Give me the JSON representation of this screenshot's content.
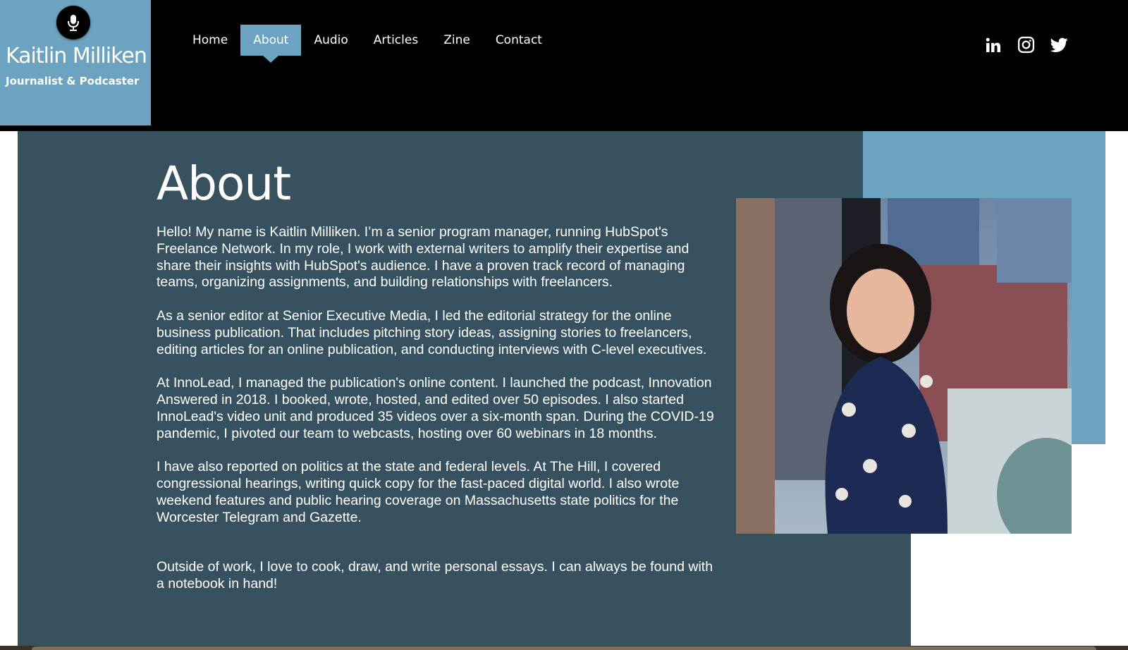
{
  "site": {
    "name": "Kaitlin Milliken",
    "tagline": "Journalist & Podcaster",
    "logo_icon": "microphone-icon"
  },
  "colors": {
    "header_bg": "#000000",
    "accent_blue": "#6ca3c0",
    "panel_slate": "#37515f",
    "text": "#ffffff"
  },
  "nav": {
    "items": [
      {
        "label": "Home",
        "active": false
      },
      {
        "label": "About",
        "active": true
      },
      {
        "label": "Audio",
        "active": false
      },
      {
        "label": "Articles",
        "active": false
      },
      {
        "label": "Zine",
        "active": false
      },
      {
        "label": "Contact",
        "active": false
      }
    ]
  },
  "social": [
    {
      "name": "LinkedIn",
      "icon": "linkedin-icon"
    },
    {
      "name": "Instagram",
      "icon": "instagram-icon"
    },
    {
      "name": "Twitter",
      "icon": "twitter-icon"
    }
  ],
  "main": {
    "title": "About",
    "paragraphs": [
      "Hello! My name is Kaitlin Milliken. I’m a senior program manager, running HubSpot's Freelance Network. In my role, I work with external writers to amplify their expertise and share their insights with HubSpot's audience. I have a proven track record of managing teams, organizing assignments, and building relationships with freelancers.",
      "As a senior editor at Senior Executive Media, I led the editorial strategy for the online business publication. That includes pitching story ideas, assigning stories to freelancers, editing articles for an online publication, and conducting interviews with C-level executives.",
      "At InnoLead, I managed the publication's online content. I launched the podcast, Innovation Answered in 2018. I booked, wrote, hosted, and edited over 50 episodes. I also started InnoLead's video unit and produced 35 videos over a six-month span. During the COVID-19 pandemic, I pivoted our team to webcasts, hosting over 60 webinars in 18 months.",
      "I have also reported on politics at the state and federal levels. At The Hill, I covered congressional hearings, writing quick copy for the fast-paced digital world. I also wrote weekend features and public hearing coverage on Massachusetts state politics for the Worcester Telegram and Gazette.",
      "Outside of work, I love to cook, draw, and write personal essays. I can always be found with a notebook in hand!"
    ],
    "photo_alt": "Portrait of Kaitlin Milliken wearing headphones by a city window"
  }
}
